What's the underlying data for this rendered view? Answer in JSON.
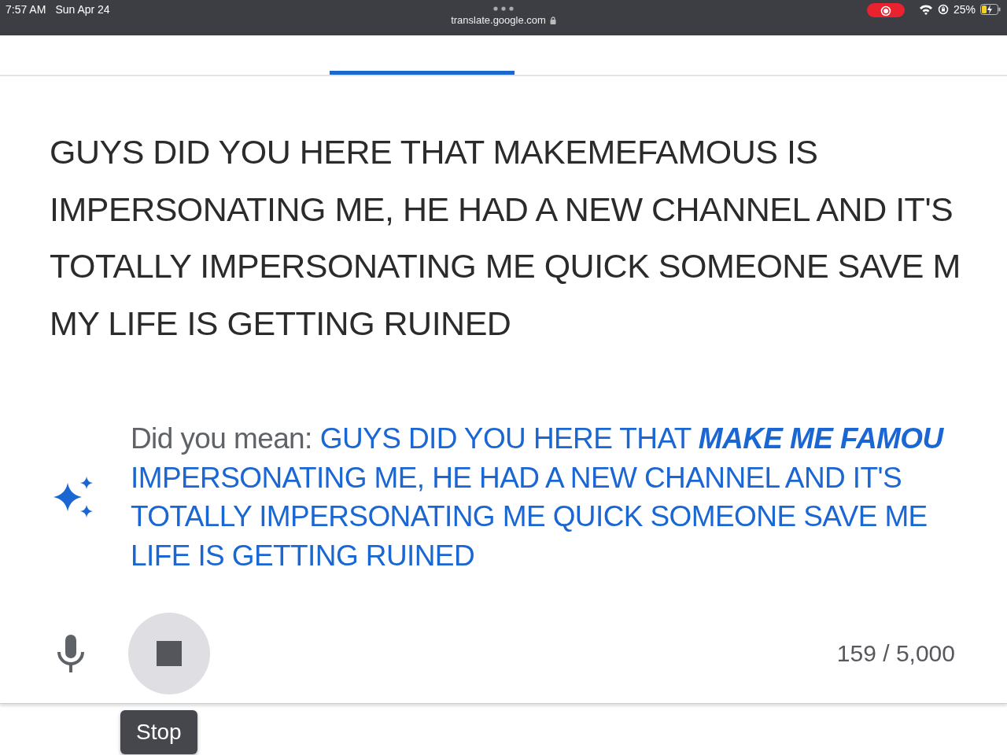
{
  "status_bar": {
    "time": "7:57 AM",
    "date": "Sun Apr 24",
    "url": "translate.google.com",
    "recording": true,
    "battery": "25%"
  },
  "tabs": [
    {
      "selected": false
    },
    {
      "selected": true
    },
    {
      "selected": false
    }
  ],
  "source_text": {
    "lines": [
      "GUYS DID YOU HERE THAT MAKEMEFAMOUS IS",
      "IMPERSONATING ME, HE HAD A NEW CHANNEL AND IT'S",
      "TOTALLY IMPERSONATING ME QUICK SOMEONE SAVE M",
      "MY LIFE IS GETTING RUINED"
    ]
  },
  "suggestion": {
    "label": "Did you mean:",
    "lines": [
      "GUYS DID YOU HERE THAT **MAKE ME FAMOU**",
      "IMPERSONATING ME, HE HAD A NEW CHANNEL AND IT'S",
      "TOTALLY IMPERSONATING ME QUICK SOMEONE SAVE ME",
      "LIFE IS GETTING RUINED"
    ]
  },
  "toolbar": {
    "recording": true,
    "tooltip": "Stop",
    "char_count": "159 / 5,000"
  }
}
